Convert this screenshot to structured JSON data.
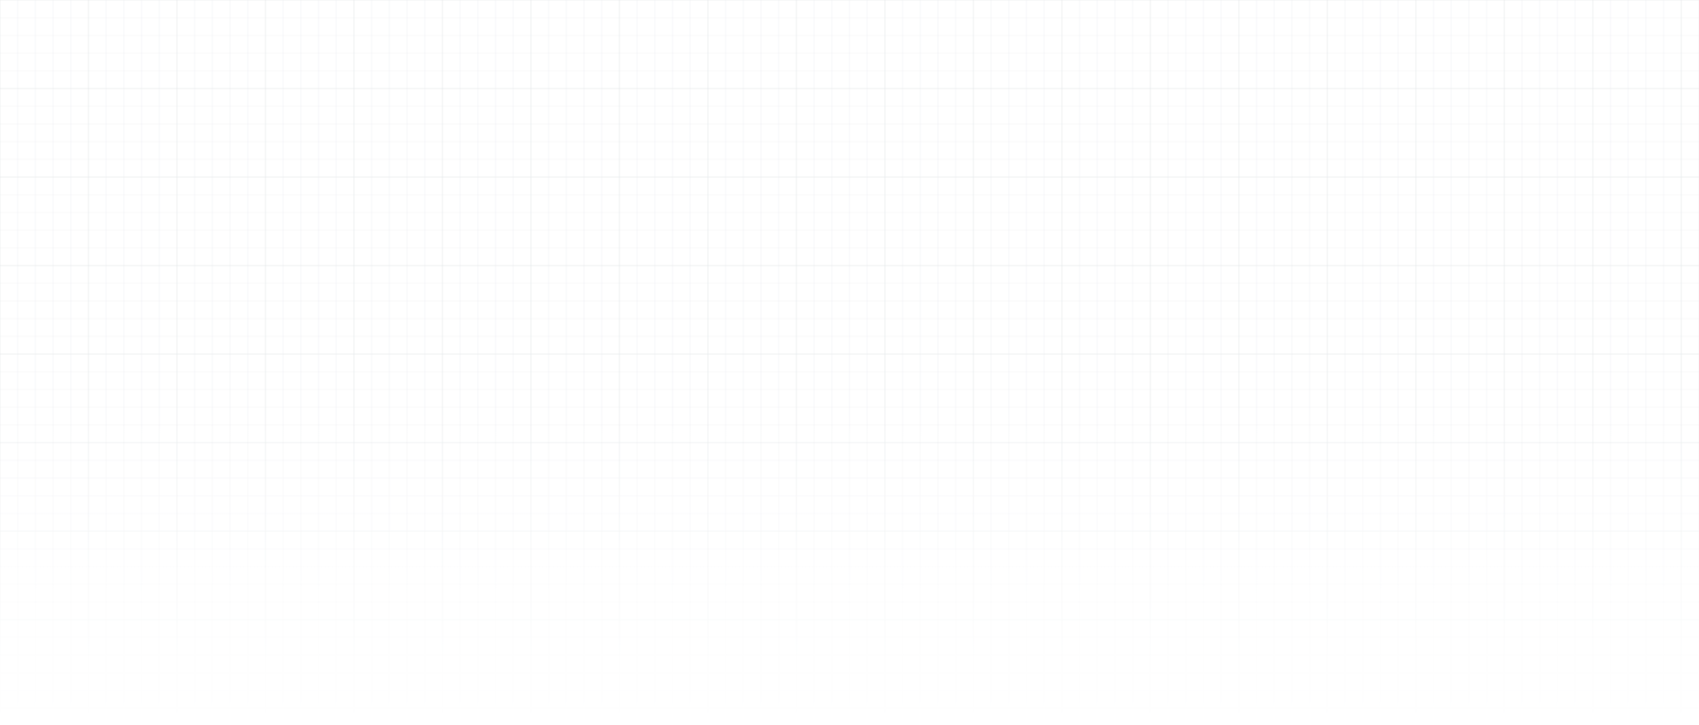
{
  "page": {
    "background_color": "#ffffff"
  },
  "grid": {
    "line_color": "#e6e8eb",
    "major_line_color": "#e2e5e8"
  }
}
